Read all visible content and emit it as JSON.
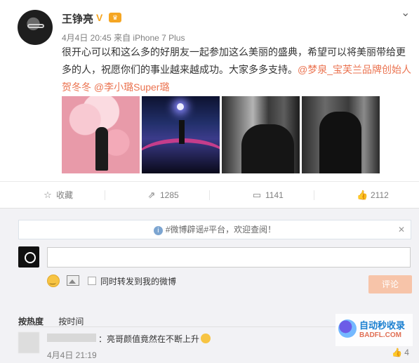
{
  "post": {
    "author": "王铮亮",
    "meta_date": "4月4日 20:45",
    "meta_from": "来自",
    "meta_device": "iPhone 7 Plus",
    "content_text": "很开心可以和这么多的好朋友一起参加这么美丽的盛典，希望可以将美丽带给更多的人，祝愿你们的事业越来越成功。大家多多支持。",
    "mention1": "@梦泉_宝芙兰品牌创始人贺冬冬",
    "mention2": "@李小璐Super璐"
  },
  "actions": {
    "favorite_label": "收藏",
    "repost_count": "1285",
    "comment_count": "1141",
    "like_count": "2112"
  },
  "comments_panel": {
    "notice": "#微博辟谣#平台，欢迎查阅！",
    "sync_label": "同时转发到我的微博",
    "submit_label": "评论",
    "sort_hot": "按热度",
    "sort_time": "按时间",
    "comment_text": "：亮哥颜值竟然在不断上升",
    "comment_time": "4月4日 21:19",
    "comment_likes": "4"
  },
  "watermark": {
    "title": "自动秒收录",
    "url": "BADFL.COM"
  },
  "colors": {
    "link": "#eb7350",
    "submit_disabled": "#f7c4a9",
    "panel_bg": "#f2f2f5"
  }
}
